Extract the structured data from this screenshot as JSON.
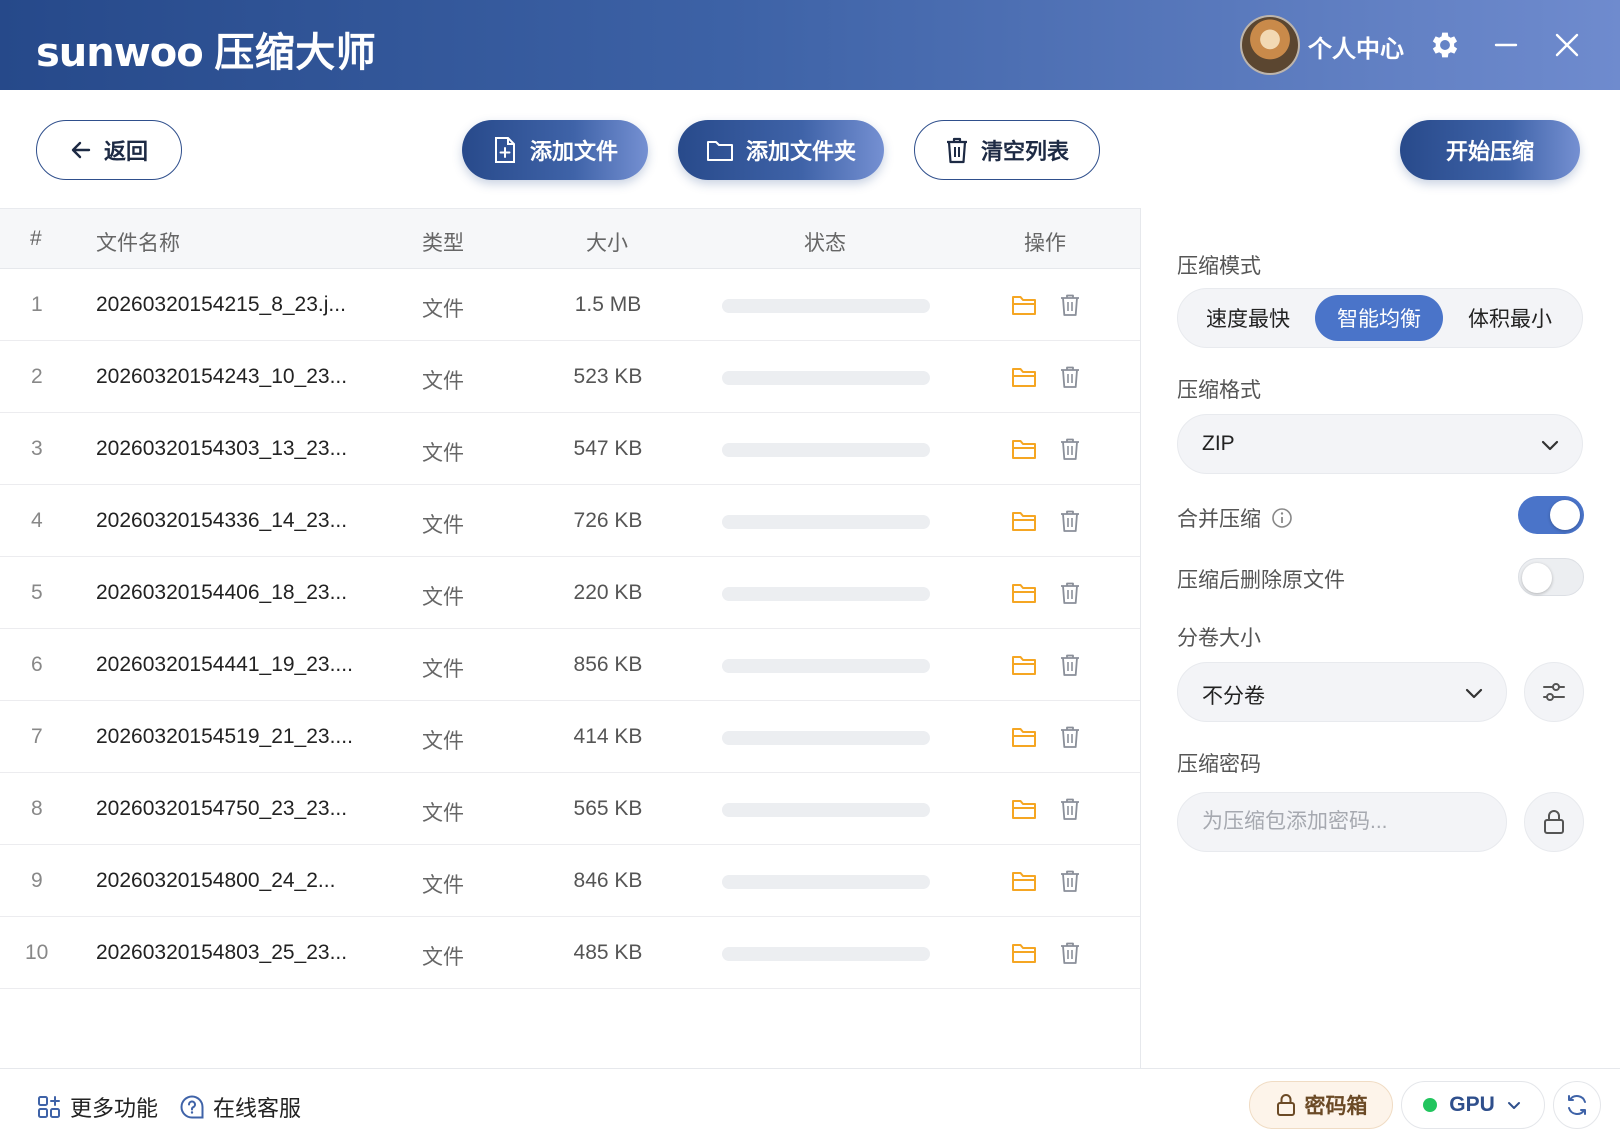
{
  "app": {
    "brand_latin": "sunwoo",
    "brand_cn": "压缩大师",
    "user_center": "个人中心"
  },
  "toolbar": {
    "back": "返回",
    "add_file": "添加文件",
    "add_folder": "添加文件夹",
    "clear_list": "清空列表",
    "start": "开始压缩"
  },
  "table": {
    "headers": {
      "idx": "#",
      "name": "文件名称",
      "type": "类型",
      "size": "大小",
      "status": "状态",
      "actions": "操作"
    },
    "rows": [
      {
        "idx": "1",
        "name": "20260320154215_8_23.j...",
        "type": "文件",
        "size": "1.5 MB",
        "progress": 0
      },
      {
        "idx": "2",
        "name": "20260320154243_10_23...",
        "type": "文件",
        "size": "523 KB",
        "progress": 0
      },
      {
        "idx": "3",
        "name": "20260320154303_13_23...",
        "type": "文件",
        "size": "547 KB",
        "progress": 0
      },
      {
        "idx": "4",
        "name": "20260320154336_14_23...",
        "type": "文件",
        "size": "726 KB",
        "progress": 0
      },
      {
        "idx": "5",
        "name": "20260320154406_18_23...",
        "type": "文件",
        "size": "220 KB",
        "progress": 0
      },
      {
        "idx": "6",
        "name": "20260320154441_19_23....",
        "type": "文件",
        "size": "856 KB",
        "progress": 0
      },
      {
        "idx": "7",
        "name": "20260320154519_21_23....",
        "type": "文件",
        "size": "414 KB",
        "progress": 0
      },
      {
        "idx": "8",
        "name": "20260320154750_23_23...",
        "type": "文件",
        "size": "565 KB",
        "progress": 0
      },
      {
        "idx": "9",
        "name": "20260320154800_24_2...",
        "type": "文件",
        "size": "846 KB",
        "progress": 0
      },
      {
        "idx": "10",
        "name": "20260320154803_25_23...",
        "type": "文件",
        "size": "485 KB",
        "progress": 0
      }
    ]
  },
  "settings": {
    "mode_label": "压缩模式",
    "modes": [
      "速度最快",
      "智能均衡",
      "体积最小"
    ],
    "selected_mode": "智能均衡",
    "format_label": "压缩格式",
    "format_value": "ZIP",
    "merge_label": "合并压缩",
    "merge_on": true,
    "delete_label": "压缩后删除原文件",
    "delete_on": false,
    "split_label": "分卷大小",
    "split_value": "不分卷",
    "password_label": "压缩密码",
    "password_placeholder": "为压缩包添加密码..."
  },
  "footer": {
    "more": "更多功能",
    "support": "在线客服",
    "password_box": "密码箱",
    "gpu": "GPU"
  },
  "colors": {
    "accent": "#4a74c9",
    "brand_dark": "#284a8b",
    "folder_icon": "#f5a623",
    "gpu_status": "#22c55e"
  }
}
